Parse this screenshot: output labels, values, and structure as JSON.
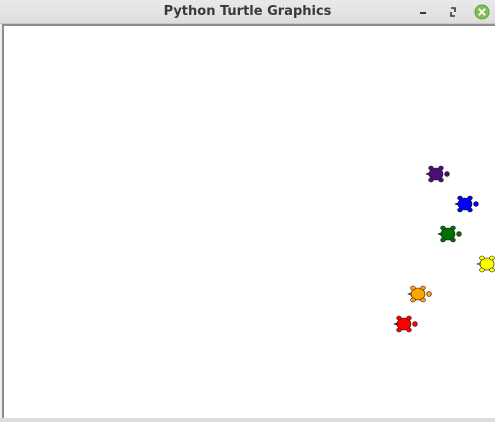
{
  "window": {
    "title": "Python Turtle Graphics",
    "controls": {
      "minimize_icon": "minimize-icon",
      "maximize_icon": "restore-icon",
      "close_icon": "close-icon",
      "close_color": "#7fbf55"
    }
  },
  "canvas": {
    "background": "#ffffff",
    "turtles": [
      {
        "color_name": "purple",
        "color": "#4b0f7a"
      },
      {
        "color_name": "blue",
        "color": "#0000ff"
      },
      {
        "color_name": "green",
        "color": "#007000"
      },
      {
        "color_name": "yellow",
        "color": "#ffff00"
      },
      {
        "color_name": "orange",
        "color": "#ffa500"
      },
      {
        "color_name": "red",
        "color": "#ff0000"
      }
    ]
  }
}
